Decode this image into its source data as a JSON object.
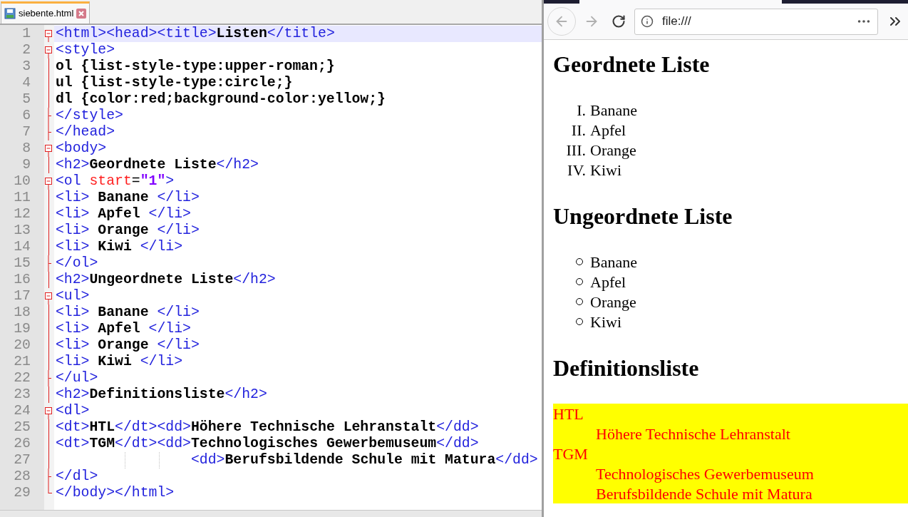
{
  "editor": {
    "tab": {
      "label": "siebente.html",
      "selected": true
    },
    "lines": [
      {
        "number": "1",
        "kind": "open",
        "current": true,
        "indented": false,
        "tokens": [
          {
            "kind": "tag",
            "text": "<html><head><title>"
          },
          {
            "kind": "text",
            "text": "Listen"
          },
          {
            "kind": "tag",
            "text": "</title>"
          }
        ]
      },
      {
        "number": "2",
        "kind": "open",
        "current": false,
        "indented": false,
        "tokens": [
          {
            "kind": "tag",
            "text": "<style>"
          }
        ]
      },
      {
        "number": "3",
        "kind": "line",
        "current": false,
        "indented": false,
        "tokens": [
          {
            "kind": "text",
            "text": "ol {list-style-type:upper-roman;}"
          }
        ]
      },
      {
        "number": "4",
        "kind": "line",
        "current": false,
        "indented": false,
        "tokens": [
          {
            "kind": "text",
            "text": "ul {list-style-type:circle;}"
          }
        ]
      },
      {
        "number": "5",
        "kind": "line",
        "current": false,
        "indented": false,
        "tokens": [
          {
            "kind": "text",
            "text": "dl {color:red;background-color:yellow;}"
          }
        ]
      },
      {
        "number": "6",
        "kind": "end",
        "current": false,
        "indented": false,
        "tokens": [
          {
            "kind": "tag",
            "text": "</style>"
          }
        ]
      },
      {
        "number": "7",
        "kind": "end",
        "current": false,
        "indented": false,
        "tokens": [
          {
            "kind": "tag",
            "text": "</head>"
          }
        ]
      },
      {
        "number": "8",
        "kind": "open",
        "current": false,
        "indented": false,
        "tokens": [
          {
            "kind": "tag",
            "text": "<body>"
          }
        ]
      },
      {
        "number": "9",
        "kind": "line",
        "current": false,
        "indented": false,
        "tokens": [
          {
            "kind": "tag",
            "text": "<h2>"
          },
          {
            "kind": "text",
            "text": "Geordnete Liste"
          },
          {
            "kind": "tag",
            "text": "</h2>"
          }
        ]
      },
      {
        "number": "10",
        "kind": "open",
        "current": false,
        "indented": false,
        "tokens": [
          {
            "kind": "tag",
            "text": "<ol"
          },
          {
            "kind": "attr",
            "text": " start"
          },
          {
            "kind": "plain",
            "text": "="
          },
          {
            "kind": "value",
            "text": "\"1\""
          },
          {
            "kind": "tag",
            "text": ">"
          }
        ]
      },
      {
        "number": "11",
        "kind": "line",
        "current": false,
        "indented": false,
        "tokens": [
          {
            "kind": "tag",
            "text": "<li>"
          },
          {
            "kind": "text",
            "text": " Banane "
          },
          {
            "kind": "tag",
            "text": "</li>"
          }
        ]
      },
      {
        "number": "12",
        "kind": "line",
        "current": false,
        "indented": false,
        "tokens": [
          {
            "kind": "tag",
            "text": "<li>"
          },
          {
            "kind": "text",
            "text": " Apfel "
          },
          {
            "kind": "tag",
            "text": "</li>"
          }
        ]
      },
      {
        "number": "13",
        "kind": "line",
        "current": false,
        "indented": false,
        "tokens": [
          {
            "kind": "tag",
            "text": "<li>"
          },
          {
            "kind": "text",
            "text": " Orange "
          },
          {
            "kind": "tag",
            "text": "</li>"
          }
        ]
      },
      {
        "number": "14",
        "kind": "line",
        "current": false,
        "indented": false,
        "tokens": [
          {
            "kind": "tag",
            "text": "<li>"
          },
          {
            "kind": "text",
            "text": " Kiwi "
          },
          {
            "kind": "tag",
            "text": "</li>"
          }
        ]
      },
      {
        "number": "15",
        "kind": "end",
        "current": false,
        "indented": false,
        "tokens": [
          {
            "kind": "tag",
            "text": "</ol>"
          }
        ]
      },
      {
        "number": "16",
        "kind": "line",
        "current": false,
        "indented": false,
        "tokens": [
          {
            "kind": "tag",
            "text": "<h2>"
          },
          {
            "kind": "text",
            "text": "Ungeordnete Liste"
          },
          {
            "kind": "tag",
            "text": "</h2>"
          }
        ]
      },
      {
        "number": "17",
        "kind": "open",
        "current": false,
        "indented": false,
        "tokens": [
          {
            "kind": "tag",
            "text": "<ul>"
          }
        ]
      },
      {
        "number": "18",
        "kind": "line",
        "current": false,
        "indented": false,
        "tokens": [
          {
            "kind": "tag",
            "text": "<li>"
          },
          {
            "kind": "text",
            "text": " Banane "
          },
          {
            "kind": "tag",
            "text": "</li>"
          }
        ]
      },
      {
        "number": "19",
        "kind": "line",
        "current": false,
        "indented": false,
        "tokens": [
          {
            "kind": "tag",
            "text": "<li>"
          },
          {
            "kind": "text",
            "text": " Apfel "
          },
          {
            "kind": "tag",
            "text": "</li>"
          }
        ]
      },
      {
        "number": "20",
        "kind": "line",
        "current": false,
        "indented": false,
        "tokens": [
          {
            "kind": "tag",
            "text": "<li>"
          },
          {
            "kind": "text",
            "text": " Orange "
          },
          {
            "kind": "tag",
            "text": "</li>"
          }
        ]
      },
      {
        "number": "21",
        "kind": "line",
        "current": false,
        "indented": false,
        "tokens": [
          {
            "kind": "tag",
            "text": "<li>"
          },
          {
            "kind": "text",
            "text": " Kiwi "
          },
          {
            "kind": "tag",
            "text": "</li>"
          }
        ]
      },
      {
        "number": "22",
        "kind": "end",
        "current": false,
        "indented": false,
        "tokens": [
          {
            "kind": "tag",
            "text": "</ul>"
          }
        ]
      },
      {
        "number": "23",
        "kind": "line",
        "current": false,
        "indented": false,
        "tokens": [
          {
            "kind": "tag",
            "text": "<h2>"
          },
          {
            "kind": "text",
            "text": "Definitionsliste"
          },
          {
            "kind": "tag",
            "text": "</h2>"
          }
        ]
      },
      {
        "number": "24",
        "kind": "open",
        "current": false,
        "indented": false,
        "tokens": [
          {
            "kind": "tag",
            "text": "<dl>"
          }
        ]
      },
      {
        "number": "25",
        "kind": "line",
        "current": false,
        "indented": false,
        "tokens": [
          {
            "kind": "tag",
            "text": "<dt>"
          },
          {
            "kind": "text",
            "text": "HTL"
          },
          {
            "kind": "tag",
            "text": "</dt><dd>"
          },
          {
            "kind": "text",
            "text": "Höhere Technische Lehranstalt"
          },
          {
            "kind": "tag",
            "text": "</dd>"
          }
        ]
      },
      {
        "number": "26",
        "kind": "line",
        "current": false,
        "indented": false,
        "tokens": [
          {
            "kind": "tag",
            "text": "<dt>"
          },
          {
            "kind": "text",
            "text": "TGM"
          },
          {
            "kind": "tag",
            "text": "</dt><dd>"
          },
          {
            "kind": "text",
            "text": "Technologisches Gewerbemuseum"
          },
          {
            "kind": "tag",
            "text": "</dd>"
          }
        ]
      },
      {
        "number": "27",
        "kind": "line",
        "current": false,
        "indented": true,
        "tokens": [
          {
            "kind": "tag",
            "text": "<dd>"
          },
          {
            "kind": "text",
            "text": "Berufsbildende Schule mit Matura"
          },
          {
            "kind": "tag",
            "text": "</dd>"
          }
        ]
      },
      {
        "number": "28",
        "kind": "end",
        "current": false,
        "indented": false,
        "tokens": [
          {
            "kind": "tag",
            "text": "</dl>"
          }
        ]
      },
      {
        "number": "29",
        "kind": "last",
        "current": false,
        "indented": false,
        "tokens": [
          {
            "kind": "tag",
            "text": "</body></html>"
          }
        ]
      }
    ]
  },
  "browser": {
    "address": "file:///",
    "sections": [
      {
        "kind": "ordered",
        "heading": "Geordnete Liste",
        "items": [
          {
            "marker": "I.",
            "text": "Banane"
          },
          {
            "marker": "II.",
            "text": "Apfel"
          },
          {
            "marker": "III.",
            "text": "Orange"
          },
          {
            "marker": "IV.",
            "text": "Kiwi"
          }
        ]
      },
      {
        "kind": "unordered",
        "heading": "Ungeordnete Liste",
        "items": [
          {
            "text": "Banane"
          },
          {
            "text": "Apfel"
          },
          {
            "text": "Orange"
          },
          {
            "text": "Kiwi"
          }
        ]
      },
      {
        "kind": "definition",
        "heading": "Definitionsliste",
        "entries": [
          {
            "term": "HTL",
            "definitions": [
              "Höhere Technische Lehranstalt"
            ]
          },
          {
            "term": "TGM",
            "definitions": [
              "Technologisches Gewerbemuseum",
              "Berufsbildende Schule mit Matura"
            ]
          }
        ]
      }
    ]
  }
}
